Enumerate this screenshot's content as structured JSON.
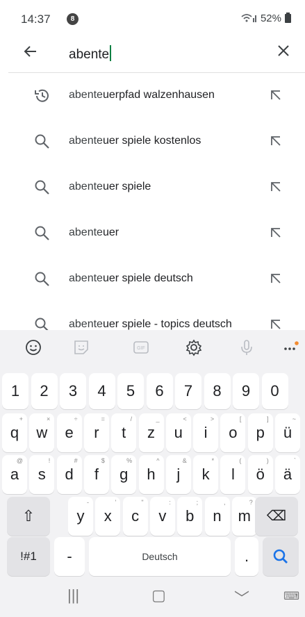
{
  "status": {
    "time": "14:37",
    "notif_count": "8",
    "battery": "52%"
  },
  "search": {
    "query": "abente"
  },
  "suggestions": [
    {
      "type": "history",
      "prefix": "abente",
      "suffix": "uerpfad walzenhausen"
    },
    {
      "type": "search",
      "prefix": "abente",
      "suffix": "uer spiele kostenlos"
    },
    {
      "type": "search",
      "prefix": "abente",
      "suffix": "uer spiele"
    },
    {
      "type": "search",
      "prefix": "abente",
      "suffix": "uer"
    },
    {
      "type": "search",
      "prefix": "abente",
      "suffix": "uer spiele deutsch"
    },
    {
      "type": "search",
      "prefix": "abente",
      "suffix": "uer spiele - topics deutsch"
    }
  ],
  "keyboard": {
    "toolbar": [
      "emoji-icon",
      "sticker-icon",
      "gif-icon",
      "settings-icon",
      "microphone-icon",
      "more-icon"
    ],
    "gif_label": "GIF",
    "numbers": [
      "1",
      "2",
      "3",
      "4",
      "5",
      "6",
      "7",
      "8",
      "9",
      "0"
    ],
    "row1": [
      "q",
      "w",
      "e",
      "r",
      "t",
      "z",
      "u",
      "i",
      "o",
      "p",
      "ü"
    ],
    "row1_sup": [
      "+",
      "×",
      "÷",
      "=",
      "/",
      "_",
      "<",
      ">",
      "[",
      "]",
      "~"
    ],
    "row2": [
      "a",
      "s",
      "d",
      "f",
      "g",
      "h",
      "j",
      "k",
      "l",
      "ö",
      "ä"
    ],
    "row2_sup": [
      "@",
      "!",
      "#",
      "$",
      "%",
      "^",
      "&",
      "*",
      "(",
      ")",
      "`"
    ],
    "row3": [
      "y",
      "x",
      "c",
      "v",
      "b",
      "n",
      "m"
    ],
    "row3_sup": [
      "-",
      "'",
      "\"",
      ":",
      ";",
      ",",
      "?"
    ],
    "symbols_label": "!#1",
    "dash_label": "-",
    "space_label": "Deutsch",
    "period_label": ".",
    "shift_glyph": "⇧",
    "backspace_glyph": "⌫"
  },
  "navbar": {
    "recent": "|||",
    "home": "▢",
    "back": "﹀",
    "keyboard": "⌨"
  }
}
